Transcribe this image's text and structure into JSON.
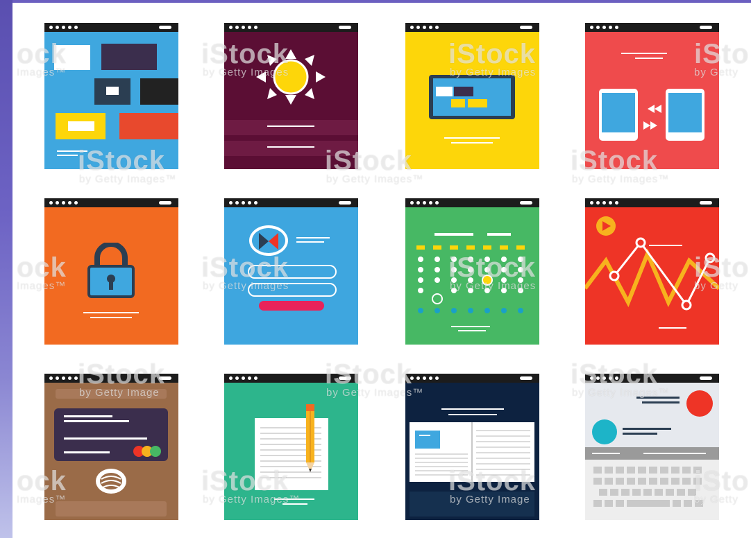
{
  "watermark": {
    "brand": "iStock",
    "byline": "by Getty Images",
    "byline_tm": "by Getty Images™",
    "fragment_brand_left": "ock",
    "fragment_byline_left": "Images™",
    "fragment_brand_right": "iSto",
    "fragment_byline_right": "by Getty",
    "fragment_byline_mid": "by Getty Image",
    "fragment_byline_mid2": "by Getty Images™"
  },
  "colors": {
    "blue": "#3fa7df",
    "plum": "#5b0e34",
    "yellow": "#fdd60a",
    "coral": "#ef4b4c",
    "orange": "#f26a21",
    "sky": "#3ea6df",
    "green": "#47b864",
    "red": "#ee3426",
    "brown": "#9a6b48",
    "teal": "#2db58c",
    "navy": "#0d2240",
    "light": "#eeeeee"
  },
  "tiles": [
    {
      "name": "layout-grid",
      "icon": "layout-blocks-icon"
    },
    {
      "name": "weather",
      "icon": "sun-icon"
    },
    {
      "name": "tablet",
      "icon": "tablet-icon"
    },
    {
      "name": "sync",
      "icon": "phones-transfer-icon"
    },
    {
      "name": "security",
      "icon": "padlock-icon"
    },
    {
      "name": "login",
      "icon": "profile-login-icon"
    },
    {
      "name": "calendar",
      "icon": "calendar-dots-icon"
    },
    {
      "name": "video-chart",
      "icon": "play-chart-icon"
    },
    {
      "name": "payment",
      "icon": "credit-card-icon"
    },
    {
      "name": "notes",
      "icon": "pencil-paper-icon"
    },
    {
      "name": "ebook",
      "icon": "open-book-icon"
    },
    {
      "name": "messaging",
      "icon": "keyboard-chat-icon"
    }
  ]
}
